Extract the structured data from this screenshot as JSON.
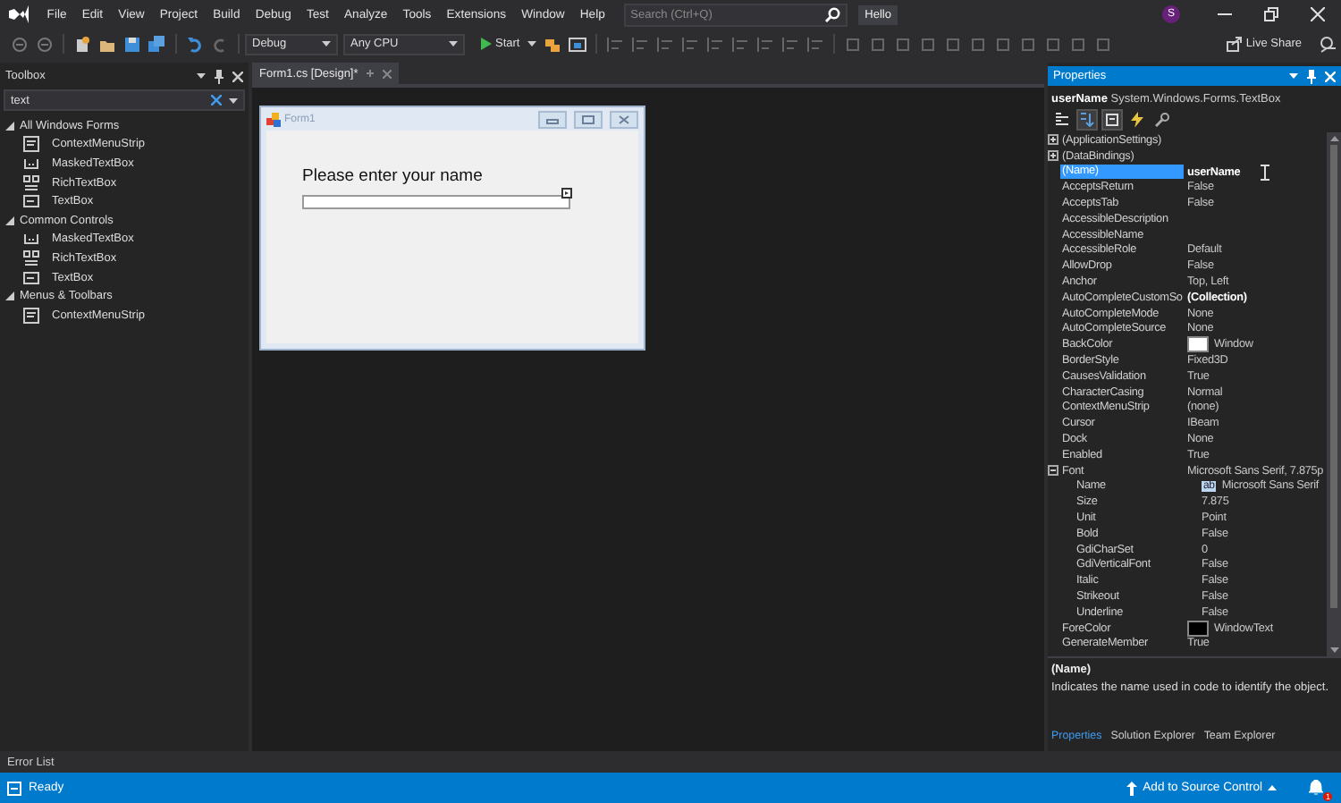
{
  "menu_bar": {
    "menus": [
      "File",
      "Edit",
      "View",
      "Project",
      "Build",
      "Debug",
      "Test",
      "Analyze",
      "Tools",
      "Extensions",
      "Window",
      "Help"
    ],
    "search": {
      "placeholder": "Search (Ctrl+Q)"
    },
    "solution_name": "Hello",
    "account_initial": "S"
  },
  "toolbar": {
    "configuration": "Debug",
    "platform": "Any CPU",
    "start_button": "Start",
    "live_share": "Live Share"
  },
  "toolbox": {
    "title": "Toolbox",
    "search": {
      "value": "text"
    },
    "groups": [
      {
        "label": "All Windows Forms",
        "expanded": true,
        "children": [
          {
            "label": "ContextMenuStrip",
            "kind": "menustrip"
          },
          {
            "label": "MaskedTextBox",
            "kind": "masked"
          },
          {
            "label": "RichTextBox",
            "kind": "rich"
          },
          {
            "label": "TextBox",
            "kind": "textbox"
          }
        ]
      },
      {
        "label": "Common Controls",
        "expanded": true,
        "children": [
          {
            "label": "MaskedTextBox",
            "kind": "masked"
          },
          {
            "label": "RichTextBox",
            "kind": "rich"
          },
          {
            "label": "TextBox",
            "kind": "textbox"
          }
        ]
      },
      {
        "label": "Menus & Toolbars",
        "expanded": true,
        "children": [
          {
            "label": "ContextMenuStrip",
            "kind": "menustrip"
          }
        ]
      }
    ]
  },
  "designer": {
    "tab": {
      "label": "Form1.cs [Design]*",
      "selected": true
    },
    "form": {
      "title": "Form1",
      "label": "Please enter your name"
    }
  },
  "properties": {
    "title": "Properties",
    "object_name": "userName",
    "object_type": "System.Windows.Forms.TextBox",
    "view_buttons": [
      {
        "kind": "categorized",
        "selected": false
      },
      {
        "kind": "alphabetical",
        "selected": true
      },
      {
        "kind": "properties",
        "selected": true
      },
      {
        "kind": "events",
        "selected": false
      },
      {
        "kind": "pages",
        "selected": false
      }
    ],
    "rows": [
      {
        "kind": "category",
        "name": "(ApplicationSettings)",
        "expanded": false
      },
      {
        "kind": "category",
        "name": "(DataBindings)",
        "expanded": false
      },
      {
        "kind": "property",
        "name": "(Name)",
        "value": "userName",
        "selected": true,
        "bold": true
      },
      {
        "kind": "property",
        "name": "AcceptsReturn",
        "value": "False",
        "selected": false,
        "bold": false
      },
      {
        "kind": "property",
        "name": "AcceptsTab",
        "value": "False",
        "selected": false,
        "bold": false
      },
      {
        "kind": "property",
        "name": "AccessibleDescription",
        "selected": false
      },
      {
        "kind": "property",
        "name": "AccessibleName",
        "selected": false
      },
      {
        "kind": "property",
        "name": "AccessibleRole",
        "value": "Default",
        "selected": false,
        "bold": false
      },
      {
        "kind": "property",
        "name": "AllowDrop",
        "value": "False",
        "selected": false,
        "bold": false
      },
      {
        "kind": "property",
        "name": "Anchor",
        "value": "Top, Left",
        "selected": false,
        "bold": false
      },
      {
        "kind": "property",
        "name": "AutoCompleteCustomSo",
        "value": "(Collection)",
        "selected": false,
        "bold": true
      },
      {
        "kind": "property",
        "name": "AutoCompleteMode",
        "value": "None",
        "selected": false,
        "bold": false
      },
      {
        "kind": "property",
        "name": "AutoCompleteSource",
        "value": "None",
        "selected": false,
        "bold": false
      },
      {
        "kind": "color",
        "name": "BackColor",
        "value": "Window",
        "color": "#ffffff",
        "selected": false,
        "bold": false
      },
      {
        "kind": "property",
        "name": "BorderStyle",
        "value": "Fixed3D",
        "selected": false,
        "bold": false
      },
      {
        "kind": "property",
        "name": "CausesValidation",
        "value": "True",
        "selected": false,
        "bold": false
      },
      {
        "kind": "property",
        "name": "CharacterCasing",
        "value": "Normal",
        "selected": false,
        "bold": false
      },
      {
        "kind": "property",
        "name": "ContextMenuStrip",
        "value": "(none)",
        "selected": false,
        "bold": false
      },
      {
        "kind": "property",
        "name": "Cursor",
        "value": "IBeam",
        "selected": false,
        "bold": false
      },
      {
        "kind": "property",
        "name": "Dock",
        "value": "None",
        "selected": false,
        "bold": false
      },
      {
        "kind": "property",
        "name": "Enabled",
        "value": "True",
        "selected": false,
        "bold": false
      },
      {
        "kind": "group",
        "name": "Font",
        "value": "Microsoft Sans Serif, 7.875p",
        "expanded": true,
        "selected": false,
        "bold": false,
        "children": [
          {
            "kind": "font",
            "name": "Name",
            "preview": "ab",
            "value": "Microsoft Sans Serif",
            "selected": false,
            "bold": false
          },
          {
            "kind": "property",
            "name": "Size",
            "value": "7.875",
            "selected": false,
            "bold": false
          },
          {
            "kind": "property",
            "name": "Unit",
            "value": "Point",
            "selected": false,
            "bold": false
          },
          {
            "kind": "property",
            "name": "Bold",
            "value": "False",
            "selected": false,
            "bold": false
          },
          {
            "kind": "property",
            "name": "GdiCharSet",
            "value": "0",
            "selected": false,
            "bold": false
          },
          {
            "kind": "property",
            "name": "GdiVerticalFont",
            "value": "False",
            "selected": false,
            "bold": false
          },
          {
            "kind": "property",
            "name": "Italic",
            "value": "False",
            "selected": false,
            "bold": false
          },
          {
            "kind": "property",
            "name": "Strikeout",
            "value": "False",
            "selected": false,
            "bold": false
          },
          {
            "kind": "property",
            "name": "Underline",
            "value": "False",
            "selected": false,
            "bold": false
          }
        ]
      },
      {
        "kind": "color",
        "name": "ForeColor",
        "value": "WindowText",
        "color": "#000000",
        "selected": false,
        "bold": false
      },
      {
        "kind": "property",
        "name": "GenerateMember",
        "value": "True",
        "selected": false,
        "bold": false
      }
    ],
    "description": {
      "title": "(Name)",
      "text": "Indicates the name used in code to identify the object."
    },
    "tabs": [
      {
        "label": "Properties",
        "selected": true
      },
      {
        "label": "Solution Explorer",
        "selected": false
      },
      {
        "label": "Team Explorer",
        "selected": false
      }
    ]
  },
  "error_list": {
    "label": "Error List"
  },
  "status_bar": {
    "state": "Ready",
    "source_control": "Add to Source Control",
    "notification_count": "1"
  }
}
